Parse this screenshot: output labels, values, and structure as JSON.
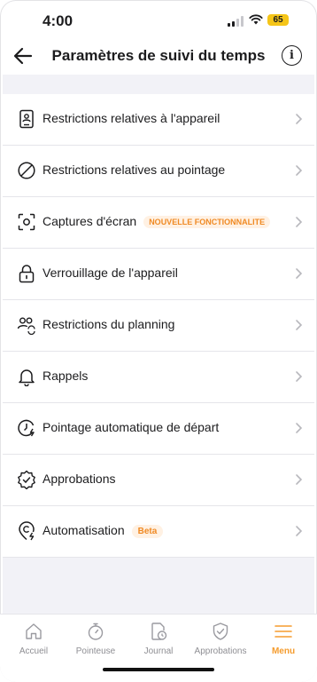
{
  "status_bar": {
    "time": "4:00",
    "battery": "65"
  },
  "header": {
    "title": "Paramètres de suivi du temps"
  },
  "settings": [
    {
      "icon": "phone-person-icon",
      "label": "Restrictions relatives à l'appareil",
      "badge": ""
    },
    {
      "icon": "prohibited-icon",
      "label": "Restrictions relatives au pointage",
      "badge": ""
    },
    {
      "icon": "screenshot-icon",
      "label": "Captures d'écran",
      "badge": "NOUVELLE FONCTIONNALITE"
    },
    {
      "icon": "lock-icon",
      "label": "Verrouillage de l'appareil",
      "badge": ""
    },
    {
      "icon": "people-sync-icon",
      "label": "Restrictions du planning",
      "badge": ""
    },
    {
      "icon": "bell-icon",
      "label": "Rappels",
      "badge": ""
    },
    {
      "icon": "auto-clock-out-icon",
      "label": "Pointage automatique de départ",
      "badge": ""
    },
    {
      "icon": "approval-badge-icon",
      "label": "Approbations",
      "badge": ""
    },
    {
      "icon": "automation-icon",
      "label": "Automatisation",
      "badge": "Beta"
    }
  ],
  "tabs": [
    {
      "icon": "home-icon",
      "label": "Accueil"
    },
    {
      "icon": "stopwatch-icon",
      "label": "Pointeuse"
    },
    {
      "icon": "journal-icon",
      "label": "Journal"
    },
    {
      "icon": "shield-check-icon",
      "label": "Approbations"
    },
    {
      "icon": "menu-icon",
      "label": "Menu"
    }
  ],
  "colors": {
    "accent": "#f59c2e",
    "badge_bg": "#fff1e3",
    "badge_text": "#f08a24"
  }
}
